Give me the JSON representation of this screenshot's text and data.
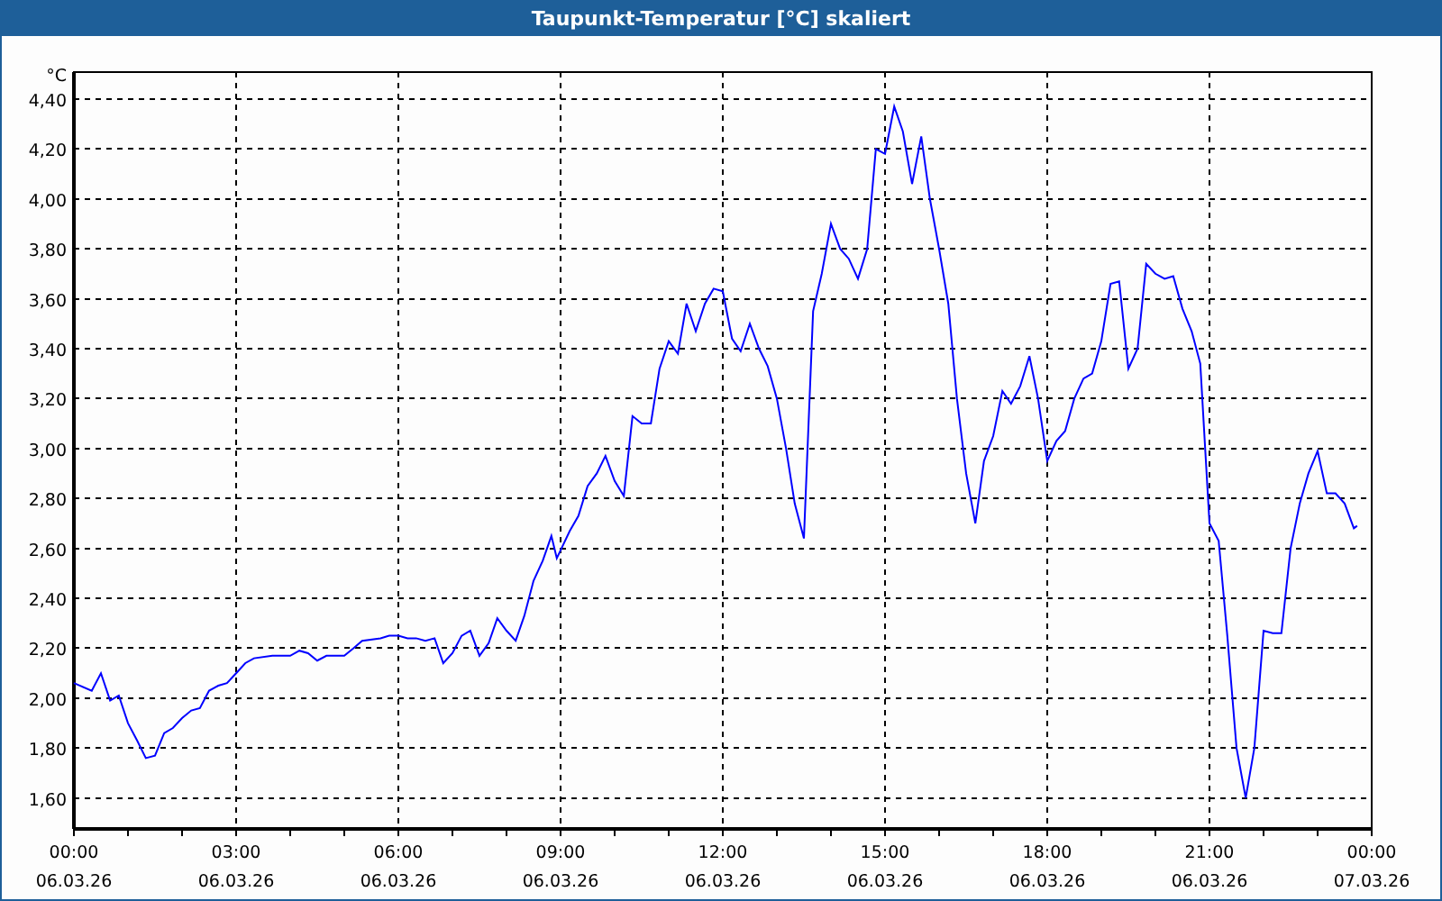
{
  "window": {
    "title": "Taupunkt-Temperatur [°C] skaliert"
  },
  "chart": {
    "chart_data": {
      "type": "line",
      "grid": true,
      "ylabel": "°C",
      "xlim": [
        0,
        24
      ],
      "ylim": [
        1.476,
        4.508
      ],
      "yticks": [
        {
          "value": 1.6,
          "label": "1,60"
        },
        {
          "value": 1.8,
          "label": "1,80"
        },
        {
          "value": 2.0,
          "label": "2,00"
        },
        {
          "value": 2.2,
          "label": "2,20"
        },
        {
          "value": 2.4,
          "label": "2,40"
        },
        {
          "value": 2.6,
          "label": "2,60"
        },
        {
          "value": 2.8,
          "label": "2,80"
        },
        {
          "value": 3.0,
          "label": "3,00"
        },
        {
          "value": 3.2,
          "label": "3,20"
        },
        {
          "value": 3.4,
          "label": "3,40"
        },
        {
          "value": 3.6,
          "label": "3,60"
        },
        {
          "value": 3.8,
          "label": "3,80"
        },
        {
          "value": 4.0,
          "label": "4,00"
        },
        {
          "value": 4.2,
          "label": "4,20"
        },
        {
          "value": 4.4,
          "label": "4,40"
        }
      ],
      "xticks": [
        {
          "value": 0,
          "label": "00:00"
        },
        {
          "value": 3,
          "label": "03:00"
        },
        {
          "value": 6,
          "label": "06:00"
        },
        {
          "value": 9,
          "label": "09:00"
        },
        {
          "value": 12,
          "label": "12:00"
        },
        {
          "value": 15,
          "label": "15:00"
        },
        {
          "value": 18,
          "label": "18:00"
        },
        {
          "value": 21,
          "label": "21:00"
        },
        {
          "value": 24,
          "label": "00:00"
        }
      ],
      "x": [
        0,
        0.33,
        0.5,
        0.67,
        0.83,
        1,
        1.17,
        1.33,
        1.5,
        1.67,
        1.83,
        2,
        2.17,
        2.33,
        2.5,
        2.67,
        2.83,
        3,
        3.17,
        3.33,
        3.67,
        4,
        4.17,
        4.33,
        4.5,
        4.67,
        5,
        5.17,
        5.33,
        5.67,
        5.83,
        6,
        6.17,
        6.33,
        6.5,
        6.67,
        6.83,
        7,
        7.17,
        7.33,
        7.5,
        7.67,
        7.83,
        8,
        8.17,
        8.33,
        8.5,
        8.67,
        8.83,
        8.93,
        9.17,
        9.33,
        9.5,
        9.67,
        9.83,
        10,
        10.17,
        10.33,
        10.5,
        10.67,
        10.83,
        11,
        11.17,
        11.33,
        11.5,
        11.67,
        11.83,
        12,
        12.17,
        12.33,
        12.5,
        12.67,
        12.83,
        13,
        13.17,
        13.33,
        13.5,
        13.67,
        13.83,
        14,
        14.17,
        14.33,
        14.5,
        14.67,
        14.83,
        15,
        15.17,
        15.33,
        15.5,
        15.67,
        15.83,
        16,
        16.17,
        16.33,
        16.5,
        16.67,
        16.83,
        17,
        17.17,
        17.33,
        17.5,
        17.67,
        17.83,
        18,
        18.17,
        18.33,
        18.5,
        18.67,
        18.83,
        19,
        19.17,
        19.33,
        19.5,
        19.67,
        19.83,
        20,
        20.17,
        20.33,
        20.5,
        20.67,
        20.83,
        21,
        21.17,
        21.33,
        21.5,
        21.67,
        21.83,
        22,
        22.17,
        22.33,
        22.5,
        22.67,
        22.83,
        23,
        23.17,
        23.33,
        23.5,
        23.67,
        23.73
      ],
      "series": [
        {
          "color": "#0000ff",
          "values": [
            2.06,
            2.03,
            2.1,
            1.99,
            2.01,
            1.9,
            1.83,
            1.76,
            1.77,
            1.86,
            1.88,
            1.92,
            1.95,
            1.96,
            2.03,
            2.05,
            2.06,
            2.1,
            2.14,
            2.16,
            2.17,
            2.17,
            2.19,
            2.18,
            2.15,
            2.17,
            2.17,
            2.2,
            2.23,
            2.24,
            2.25,
            2.25,
            2.24,
            2.24,
            2.23,
            2.24,
            2.14,
            2.18,
            2.25,
            2.27,
            2.17,
            2.22,
            2.32,
            2.27,
            2.23,
            2.33,
            2.47,
            2.55,
            2.65,
            2.56,
            2.67,
            2.73,
            2.85,
            2.9,
            2.97,
            2.87,
            2.81,
            3.13,
            3.1,
            3.1,
            3.32,
            3.43,
            3.38,
            3.58,
            3.47,
            3.58,
            3.64,
            3.63,
            3.44,
            3.39,
            3.5,
            3.4,
            3.33,
            3.2,
            3.0,
            2.78,
            2.64,
            3.55,
            3.7,
            3.9,
            3.8,
            3.76,
            3.68,
            3.8,
            4.2,
            4.18,
            4.37,
            4.27,
            4.06,
            4.25,
            4.0,
            3.8,
            3.58,
            3.2,
            2.9,
            2.7,
            2.95,
            3.05,
            3.23,
            3.18,
            3.25,
            3.37,
            3.2,
            2.95,
            3.03,
            3.07,
            3.2,
            3.28,
            3.3,
            3.43,
            3.66,
            3.67,
            3.32,
            3.4,
            3.74,
            3.7,
            3.68,
            3.69,
            3.56,
            3.47,
            3.34,
            2.7,
            2.63,
            2.25,
            1.8,
            1.6,
            1.8,
            2.27,
            2.26,
            2.26,
            2.6,
            2.78,
            2.9,
            2.99,
            2.82,
            2.82,
            2.78,
            2.68,
            2.69
          ]
        }
      ]
    },
    "date_labels": [
      "06.03.26",
      "06.03.26",
      "06.03.26",
      "06.03.26",
      "06.03.26",
      "06.03.26",
      "06.03.26",
      "06.03.26",
      "07.03.26"
    ]
  }
}
